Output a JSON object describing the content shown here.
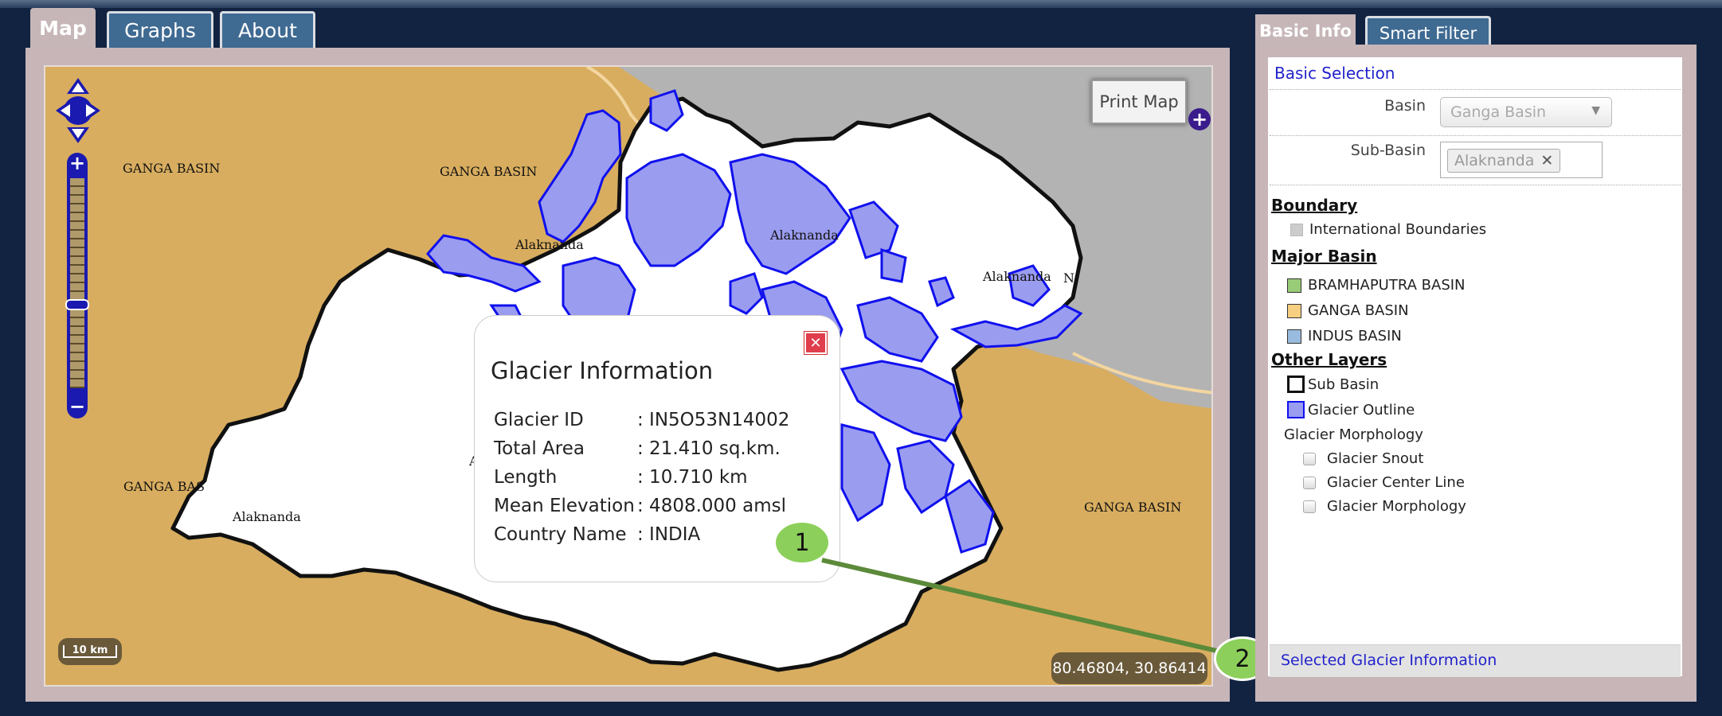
{
  "tabs": {
    "map": "Map",
    "graphs": "Graphs",
    "about": "About"
  },
  "map": {
    "print_label": "Print Map",
    "plus_label": "+",
    "scale_label": "10 km",
    "coords": "80.46804, 30.86414",
    "zoom_in": "+",
    "zoom_out": "−",
    "labels": {
      "ganga_tl": "GANGA BASIN",
      "ganga_top": "GANGA BASIN",
      "ganga_left": "GANGA BAS",
      "ganga_right": "GANGA BASIN",
      "alak_left": "Alaknanda",
      "alak_top": "Alaknanda",
      "alak_mid": "Alaknanda",
      "alak_right": "Alaknanda",
      "alak_frag": "A",
      "n_frag": "N"
    },
    "colors": {
      "ganga": "#d8ad5f",
      "outside": "#b3b3b3",
      "subbasin": "#ffffff",
      "glacier_fill": "#9a9cf0",
      "glacier_stroke": "#1010ee"
    }
  },
  "popup": {
    "title": "Glacier Information",
    "close_icon": "close-icon",
    "rows": [
      {
        "key": "Glacier ID",
        "value": ": IN5O53N14002"
      },
      {
        "key": "Total Area",
        "value": ": 21.410 sq.km."
      },
      {
        "key": "Length",
        "value": ": 10.710 km"
      },
      {
        "key": "Mean Elevation",
        "value": ": 4808.000 amsl"
      },
      {
        "key": "Country Name",
        "value": ": INDIA"
      }
    ]
  },
  "callouts": {
    "one": "1",
    "two": "2"
  },
  "right": {
    "tabs": {
      "basic": "Basic Info",
      "smart": "Smart Filter"
    },
    "basic_selection": "Basic Selection",
    "basin_label": "Basin",
    "basin_value": "Ganga Basin",
    "subbasin_label": "Sub-Basin",
    "subbasin_chip": "Alaknanda",
    "chip_remove": "✕",
    "boundary_head": "Boundary",
    "international": "International Boundaries",
    "major_head": "Major Basin",
    "bramhaputra": "BRAMHAPUTRA BASIN",
    "ganga": "GANGA BASIN",
    "indus": "INDUS BASIN",
    "other_head": "Other Layers",
    "sub_basin": "Sub Basin",
    "glacier_outline": "Glacier Outline",
    "glacier_morph_group": "Glacier Morphology",
    "glacier_snout": "Glacier Snout",
    "glacier_center": "Glacier Center Line",
    "glacier_morph": "Glacier Morphology",
    "footer": "Selected Glacier Information",
    "colors": {
      "international": "#cccccc",
      "bramhaputra": "#99cc77",
      "ganga": "#f7cf80",
      "indus": "#99bbdd",
      "glacier_outline": "#9a9cf0"
    }
  }
}
